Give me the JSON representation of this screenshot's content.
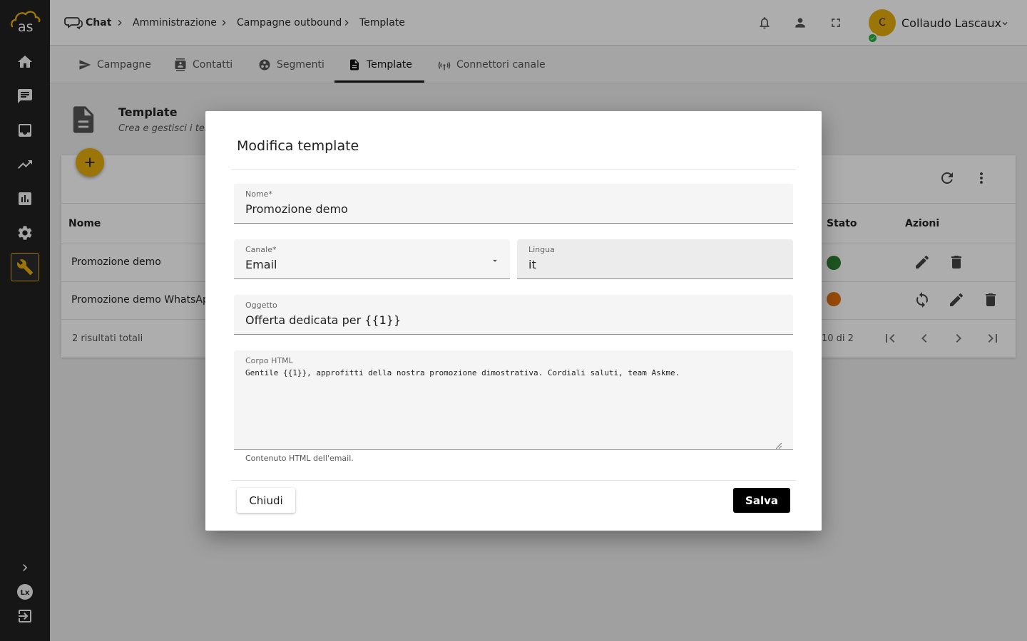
{
  "colors": {
    "accent": "#e5ad0b",
    "sidebar": "#212121",
    "status_green": "#2e7d32",
    "status_orange": "#e07010"
  },
  "logo": {
    "text": "as"
  },
  "sidebar": {
    "items": [
      {
        "icon": "home-icon"
      },
      {
        "icon": "chat-icon"
      },
      {
        "icon": "inbox-icon"
      },
      {
        "icon": "trending-icon"
      },
      {
        "icon": "bar-chart-icon"
      },
      {
        "icon": "gear-icon"
      },
      {
        "icon": "wrench-icon",
        "active": true
      }
    ],
    "bottom": [
      {
        "icon": "chevron-right-icon"
      },
      {
        "icon": "lx-icon"
      },
      {
        "icon": "logout-icon"
      }
    ]
  },
  "breadcrumb": {
    "items": [
      "Chat",
      "Amministrazione",
      "Campagne outbound",
      "Template"
    ]
  },
  "user": {
    "initial": "C",
    "name": "Collaudo Lascaux"
  },
  "tabs": [
    {
      "label": "Campagne",
      "icon": "send-icon"
    },
    {
      "label": "Contatti",
      "icon": "contacts-icon"
    },
    {
      "label": "Segmenti",
      "icon": "segments-icon"
    },
    {
      "label": "Template",
      "icon": "document-icon",
      "active": true
    },
    {
      "label": "Connettori canale",
      "icon": "antenna-icon"
    }
  ],
  "page": {
    "title": "Template",
    "subtitle": "Crea e gestisci i tem"
  },
  "table": {
    "headers": {
      "name": "Nome",
      "status": "Stato",
      "actions": "Azioni"
    },
    "rows": [
      {
        "name": "Promozione demo",
        "status": "green"
      },
      {
        "name": "Promozione demo WhatsApp",
        "status": "orange"
      }
    ],
    "total": "2 risultati totali",
    "range": "10 di 2"
  },
  "modal": {
    "title": "Modifica template",
    "name_label": "Nome*",
    "name_value": "Promozione demo",
    "channel_label": "Canale*",
    "channel_value": "Email",
    "language_label": "Lingua",
    "language_value": "it",
    "subject_label": "Oggetto",
    "subject_value": "Offerta dedicata per {{1}}",
    "body_label": "Corpo HTML",
    "body_value": "Gentile {{1}}, approfitti della nostra promozione dimostrativa. Cordiali saluti, team Askme.",
    "body_hint": "Contenuto HTML dell'email.",
    "close_label": "Chiudi",
    "save_label": "Salva"
  }
}
